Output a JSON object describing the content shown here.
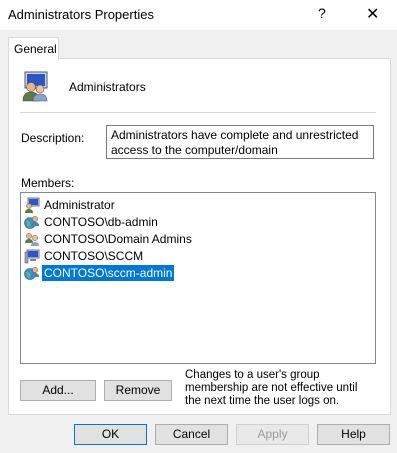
{
  "window": {
    "title": "Administrators Properties",
    "help_glyph": "?",
    "close_glyph": "✕"
  },
  "tabs": [
    {
      "label": "General",
      "selected": true
    }
  ],
  "group": {
    "name": "Administrators",
    "icon": "group-users-icon"
  },
  "description": {
    "label": "Description:",
    "value": "Administrators have complete and unrestricted access to the computer/domain"
  },
  "members": {
    "label": "Members:",
    "items": [
      {
        "name": "Administrator",
        "icon": "user-computer-icon",
        "selected": false
      },
      {
        "name": "CONTOSO\\db-admin",
        "icon": "globe-user-icon",
        "selected": false
      },
      {
        "name": "CONTOSO\\Domain Admins",
        "icon": "group-users-icon",
        "selected": false
      },
      {
        "name": "CONTOSO\\SCCM",
        "icon": "computer-icon",
        "selected": false
      },
      {
        "name": "CONTOSO\\sccm-admin",
        "icon": "globe-user-icon",
        "selected": true
      }
    ]
  },
  "actions": {
    "add": "Add...",
    "remove": "Remove",
    "note": "Changes to a user's group membership are not effective until the next time the user logs on."
  },
  "footer": {
    "ok": "OK",
    "cancel": "Cancel",
    "apply": "Apply",
    "help": "Help"
  },
  "colors": {
    "selection": "#0078d7",
    "default_button_border": "#0078d7"
  }
}
